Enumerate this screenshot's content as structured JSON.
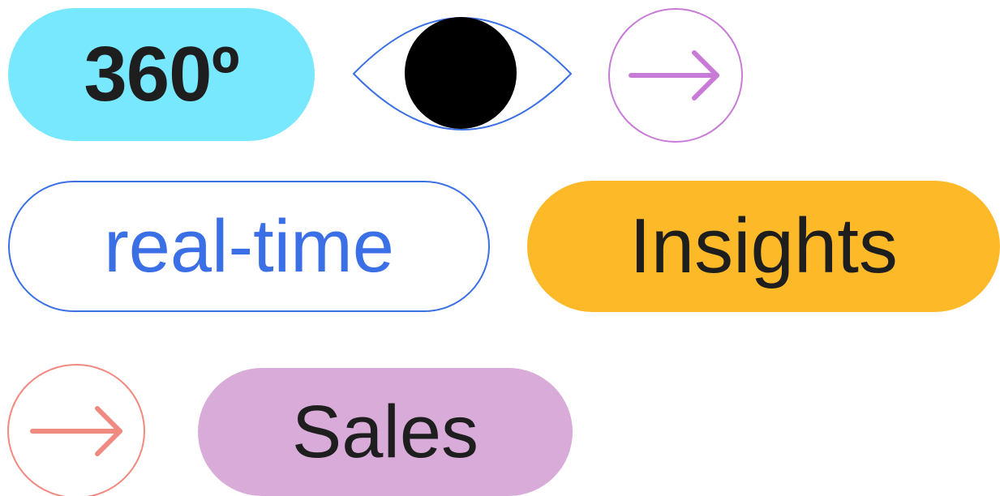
{
  "badges": {
    "three_sixty": "360º",
    "real_time": "real-time",
    "insights": "Insights",
    "sales": "Sales"
  },
  "colors": {
    "cyan_pill": "#78E8FF",
    "blue_outline": "#3B6FE6",
    "yellow_pill": "#FDB927",
    "purple_pill": "#D8ABD9",
    "purple_arrow": "#C77BD6",
    "red_arrow": "#F08A80",
    "text_dark": "#1e1e1e",
    "eye_pupil": "#000000"
  },
  "icons": {
    "eye": "eye-icon",
    "purple_arrow": "arrow-right-circle-icon",
    "red_arrow": "arrow-right-circle-icon"
  }
}
